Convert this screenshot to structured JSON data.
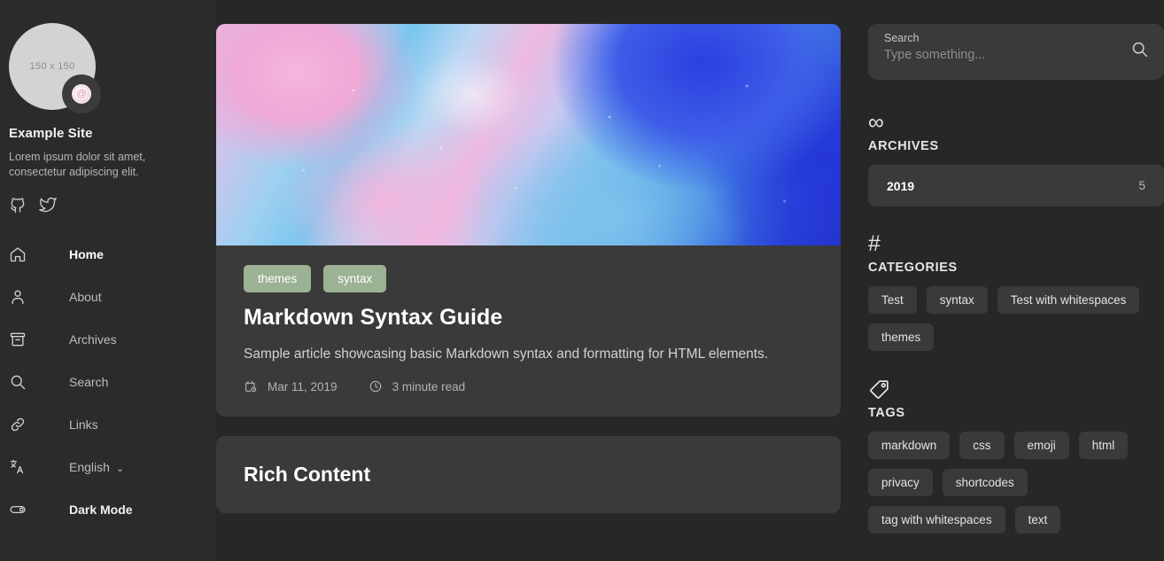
{
  "left_sidebar": {
    "avatar": {
      "placeholder_text": "150 x 150",
      "badge_icon": "spiral-logo-icon"
    },
    "site_title": "Example Site",
    "site_description": "Lorem ipsum dolor sit amet, consectetur adipiscing elit.",
    "social": [
      {
        "name": "github-icon",
        "label": "GitHub"
      },
      {
        "name": "twitter-icon",
        "label": "Twitter"
      }
    ],
    "nav": [
      {
        "label": "Home",
        "icon": "home-icon",
        "active": true
      },
      {
        "label": "About",
        "icon": "user-icon",
        "active": false
      },
      {
        "label": "Archives",
        "icon": "archive-box-icon",
        "active": false
      },
      {
        "label": "Search",
        "icon": "search-icon",
        "active": false
      },
      {
        "label": "Links",
        "icon": "link-icon",
        "active": false
      }
    ],
    "language": {
      "label": "English",
      "icon": "translate-icon",
      "chevron": "⌄"
    },
    "dark_mode": {
      "label": "Dark Mode",
      "icon": "toggle-switch-icon"
    }
  },
  "main": {
    "post": {
      "hero_image_alt": "abstract fluid art pink blue",
      "tags": [
        "themes",
        "syntax"
      ],
      "title": "Markdown Syntax Guide",
      "summary": "Sample article showcasing basic Markdown syntax and formatting for HTML elements.",
      "date": "Mar 11, 2019",
      "date_icon": "calendar-icon",
      "read_time": "3 minute read",
      "read_time_icon": "clock-icon"
    },
    "next_post": {
      "title": "Rich Content"
    }
  },
  "right_sidebar": {
    "search": {
      "label": "Search",
      "placeholder": "Type something...",
      "value": "",
      "icon": "search-icon"
    },
    "archives": {
      "symbol": "∞",
      "heading": "ARCHIVES",
      "rows": [
        {
          "year": "2019",
          "count": "5"
        }
      ]
    },
    "categories": {
      "symbol": "#",
      "heading": "CATEGORIES",
      "items": [
        "Test",
        "syntax",
        "Test with whitespaces",
        "themes"
      ]
    },
    "tags": {
      "icon": "tag-icon",
      "heading": "TAGS",
      "items": [
        "markdown",
        "css",
        "emoji",
        "html",
        "privacy",
        "shortcodes",
        "tag with whitespaces",
        "text"
      ]
    }
  },
  "colors": {
    "page_bg": "#272727",
    "sidebar_bg": "#2b2b2b",
    "card_bg": "#3a3a3a",
    "pill_green": "#9cb294",
    "text_primary": "#ffffff",
    "text_secondary": "#b6b6b6"
  }
}
